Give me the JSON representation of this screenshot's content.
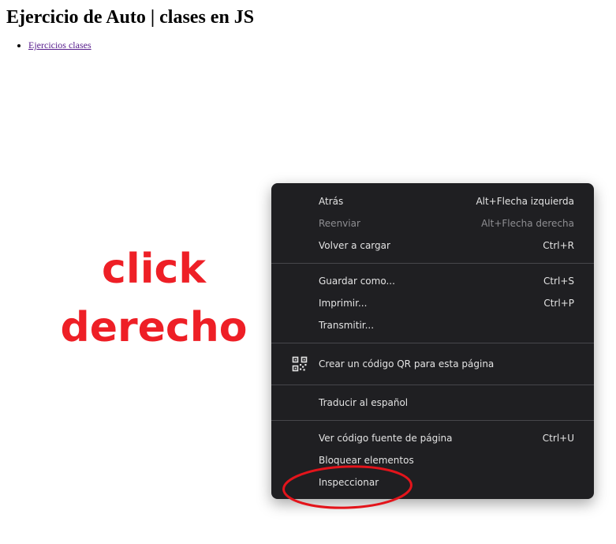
{
  "page": {
    "title": "Ejercicio de Auto | clases en JS",
    "links": [
      {
        "label": "Ejercicios clases"
      }
    ]
  },
  "annotation": {
    "line1": "click",
    "line2": "derecho",
    "color": "#ee1f26"
  },
  "context_menu": {
    "sections": [
      [
        {
          "label": "Atrás",
          "shortcut": "Alt+Flecha izquierda",
          "disabled": false
        },
        {
          "label": "Reenviar",
          "shortcut": "Alt+Flecha derecha",
          "disabled": true
        },
        {
          "label": "Volver a cargar",
          "shortcut": "Ctrl+R",
          "disabled": false
        }
      ],
      [
        {
          "label": "Guardar como...",
          "shortcut": "Ctrl+S",
          "disabled": false
        },
        {
          "label": "Imprimir...",
          "shortcut": "Ctrl+P",
          "disabled": false
        },
        {
          "label": "Transmitir...",
          "shortcut": "",
          "disabled": false
        }
      ],
      [
        {
          "label": "Crear un código QR para esta página",
          "shortcut": "",
          "icon": "qr-code-icon",
          "disabled": false
        }
      ],
      [
        {
          "label": "Traducir al español",
          "shortcut": "",
          "disabled": false
        }
      ],
      [
        {
          "label": "Ver código fuente de página",
          "shortcut": "Ctrl+U",
          "disabled": false
        },
        {
          "label": "Bloquear elementos",
          "shortcut": "",
          "disabled": false
        },
        {
          "label": "Inspeccionar",
          "shortcut": "",
          "highlighted": true,
          "disabled": false
        }
      ]
    ],
    "background": "#1f1f22"
  }
}
